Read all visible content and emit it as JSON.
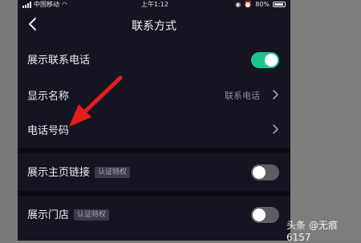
{
  "status_bar": {
    "carrier": "中国移动",
    "time": "上午1:12",
    "battery": "80%"
  },
  "header": {
    "title": "联系方式"
  },
  "settings": [
    {
      "label": "展示联系电话",
      "toggle": true
    },
    {
      "label": "显示名称",
      "value": "联系电话"
    },
    {
      "label": "电话号码"
    },
    {
      "label": "展示主页链接",
      "badge": "认证特权",
      "toggle": false
    },
    {
      "label": "展示门店",
      "badge": "认证特权",
      "toggle": false
    }
  ],
  "watermark": {
    "text": "头条 @无痕6157"
  },
  "colors": {
    "background": "#151522",
    "toggle_on": "#20c48a",
    "toggle_off": "#5d5d66",
    "annotation_arrow": "#e41e1e"
  }
}
